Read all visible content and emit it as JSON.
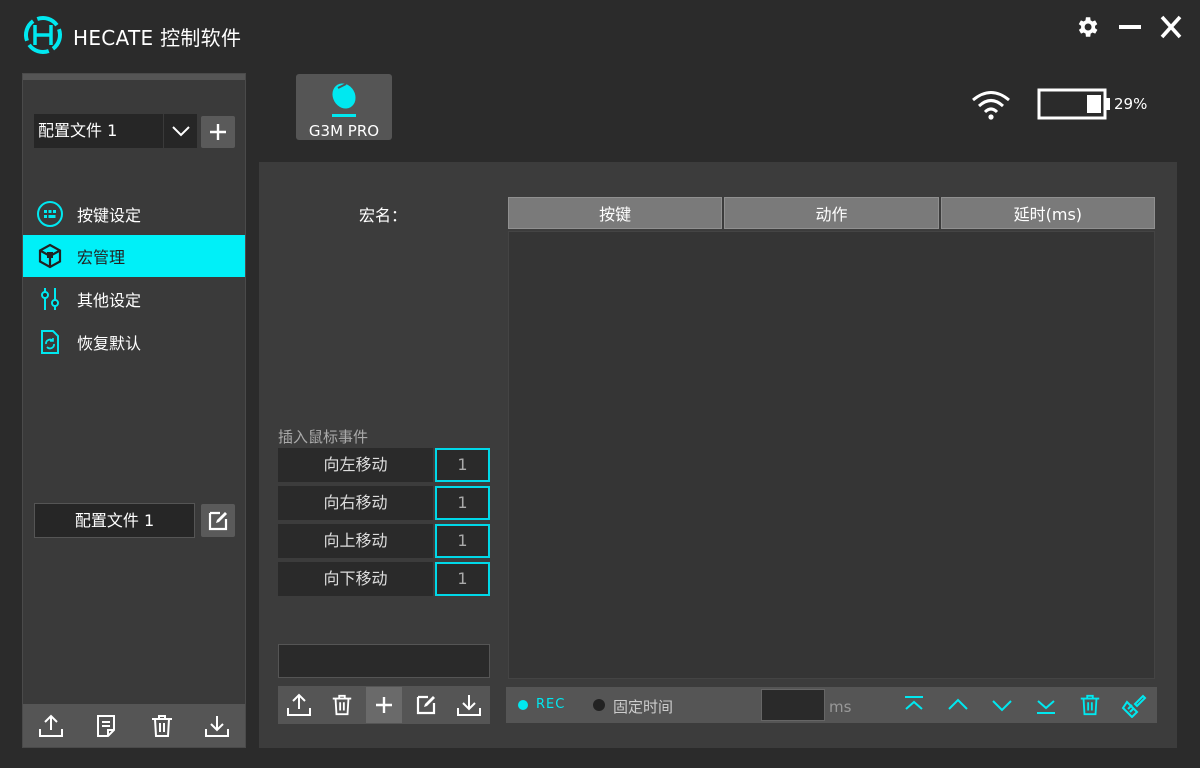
{
  "window": {
    "title": "HECATE 控制软件",
    "controls": [
      "gear-icon",
      "minimize-icon",
      "close-icon"
    ]
  },
  "sidebar": {
    "profile_select_value": "配置文件 1",
    "nav": [
      {
        "label": "按键设定",
        "icon": "keys-icon",
        "active": false
      },
      {
        "label": "宏管理",
        "icon": "macro-cube-icon",
        "active": true
      },
      {
        "label": "其他设定",
        "icon": "sliders-icon",
        "active": false
      },
      {
        "label": "恢复默认",
        "icon": "restore-icon",
        "active": false
      }
    ],
    "profile_name": "配置文件 1",
    "bottom_tools": [
      "upload-icon",
      "notes-icon",
      "trash-icon",
      "download-icon"
    ]
  },
  "device": {
    "name": "G3M PRO",
    "icon": "mouse-icon"
  },
  "status": {
    "wifi_icon": "wifi-icon",
    "battery_percent_label": "29%",
    "battery_level": 0.29
  },
  "macro": {
    "name_label": "宏名：",
    "table_headers": [
      "按键",
      "动作",
      "延时(ms)"
    ],
    "rows": [],
    "insert_label": "插入鼠标事件",
    "moves": [
      {
        "label": "向左移动",
        "value": "1"
      },
      {
        "label": "向右移动",
        "value": "1"
      },
      {
        "label": "向上移动",
        "value": "1"
      },
      {
        "label": "向下移动",
        "value": "1"
      }
    ],
    "tools": [
      "upload-icon",
      "trash-icon",
      "add-icon",
      "edit-icon",
      "download-icon"
    ],
    "rec_label": "REC",
    "fixed_time_label": "固定时间",
    "ms_label": "ms",
    "rec_tools": [
      "move-top-icon",
      "move-up-icon",
      "move-down-icon",
      "move-bottom-icon",
      "trash-icon",
      "clear-brush-icon"
    ]
  },
  "colors": {
    "accent": "#00f0f8",
    "background": "#2b2b2b",
    "panel": "#3c3c3c"
  }
}
